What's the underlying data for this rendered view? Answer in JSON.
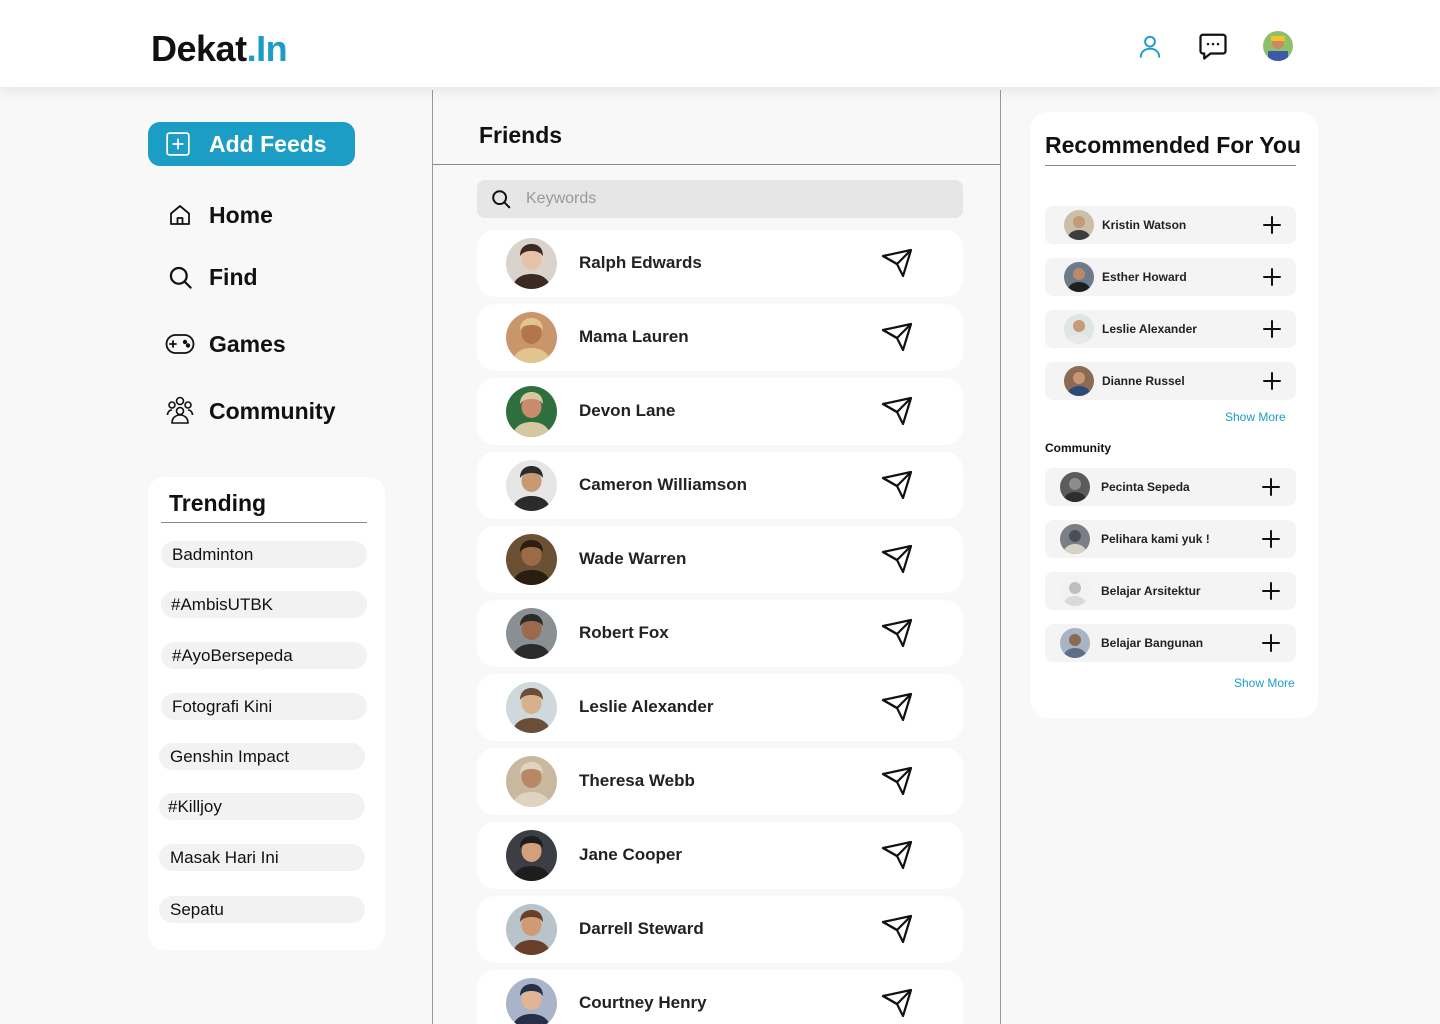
{
  "header": {
    "logo_main": "Dekat",
    "logo_accent": ".In",
    "icons": [
      "user-icon",
      "chat-icon",
      "profile-avatar"
    ]
  },
  "sidebar": {
    "add_feeds_label": "Add Feeds",
    "nav": [
      {
        "label": "Home",
        "icon": "home-icon"
      },
      {
        "label": "Find",
        "icon": "search-icon"
      },
      {
        "label": "Games",
        "icon": "gamepad-icon"
      },
      {
        "label": "Community",
        "icon": "community-icon"
      }
    ],
    "trending": {
      "title": "Trending",
      "tags": [
        "Badminton",
        "#AmbisUTBK",
        "#AyoBersepeda",
        "Fotografi Kini",
        "Genshin Impact",
        "#Killjoy",
        "Masak Hari Ini",
        "Sepatu"
      ]
    }
  },
  "friends": {
    "title": "Friends",
    "search_placeholder": "Keywords",
    "list": [
      "Ralph Edwards",
      "Mama Lauren",
      "Devon Lane",
      "Cameron Williamson",
      "Wade Warren",
      "Robert Fox",
      "Leslie Alexander",
      "Theresa Webb",
      "Jane Cooper",
      "Darrell Steward",
      "Courtney Henry"
    ]
  },
  "recommended": {
    "title": "Recommended For You",
    "people": [
      "Kristin Watson",
      "Esther Howard",
      "Leslie Alexander",
      "Dianne Russel"
    ],
    "show_more": "Show More",
    "community_label": "Community",
    "communities": [
      "Pecinta Sepeda",
      "Pelihara kami yuk !",
      "Belajar Arsitektur",
      "Belajar Bangunan"
    ],
    "community_show_more": "Show More"
  },
  "colors": {
    "accent": "#1b9dc6",
    "background": "#f8f8f8"
  }
}
